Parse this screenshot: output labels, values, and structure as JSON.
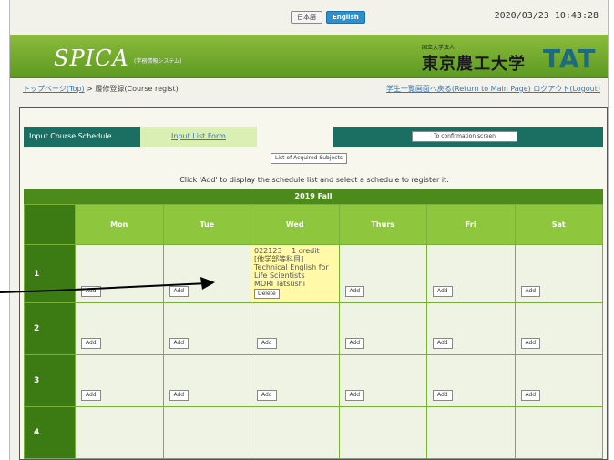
{
  "topbar": {
    "lang_ja": "日本語",
    "lang_en": "English",
    "datetime": "2020/03/23 10:43:28"
  },
  "header": {
    "logo": "SPICA",
    "logo_sub": "(学務情報システム)",
    "univ_small": "国立大学法人",
    "univ_name": "東京農工大学",
    "univ_mark": "TAT"
  },
  "breadcrumb": {
    "top_link": "トップページ(Top)",
    "separator": " > ",
    "current": "履修登録(Course regist)"
  },
  "navlinks": {
    "return": "学生一覧画面へ戻る(Return to Main Page)",
    "logout": "ログアウト(Logout)"
  },
  "tabs": {
    "input_schedule": "Input Course Schedule",
    "input_list": "Input List Form",
    "confirm": "To confirmation screen"
  },
  "acquired_button": "List of Acquired Subjects",
  "instruction": "Click 'Add' to display the schedule list and select a schedule to register it.",
  "term": "2019 Fall",
  "days": [
    "Mon",
    "Tue",
    "Wed",
    "Thurs",
    "Fri",
    "Sat"
  ],
  "periods": [
    "1",
    "2",
    "3",
    "4"
  ],
  "add_label": "Add",
  "course": {
    "code_credit": "022123　 1 credit",
    "category": "[他学部等科目]",
    "title": "Technical English for Life Scientists",
    "instructor": "MORI Tatsushi",
    "delete_label": "Delete"
  },
  "colors": {
    "header_green": "#6fa52b",
    "tab_teal": "#1a6e62",
    "day_header": "#8ec63e",
    "period_cell": "#3c7a14",
    "registered_course": "#fff9a8"
  }
}
